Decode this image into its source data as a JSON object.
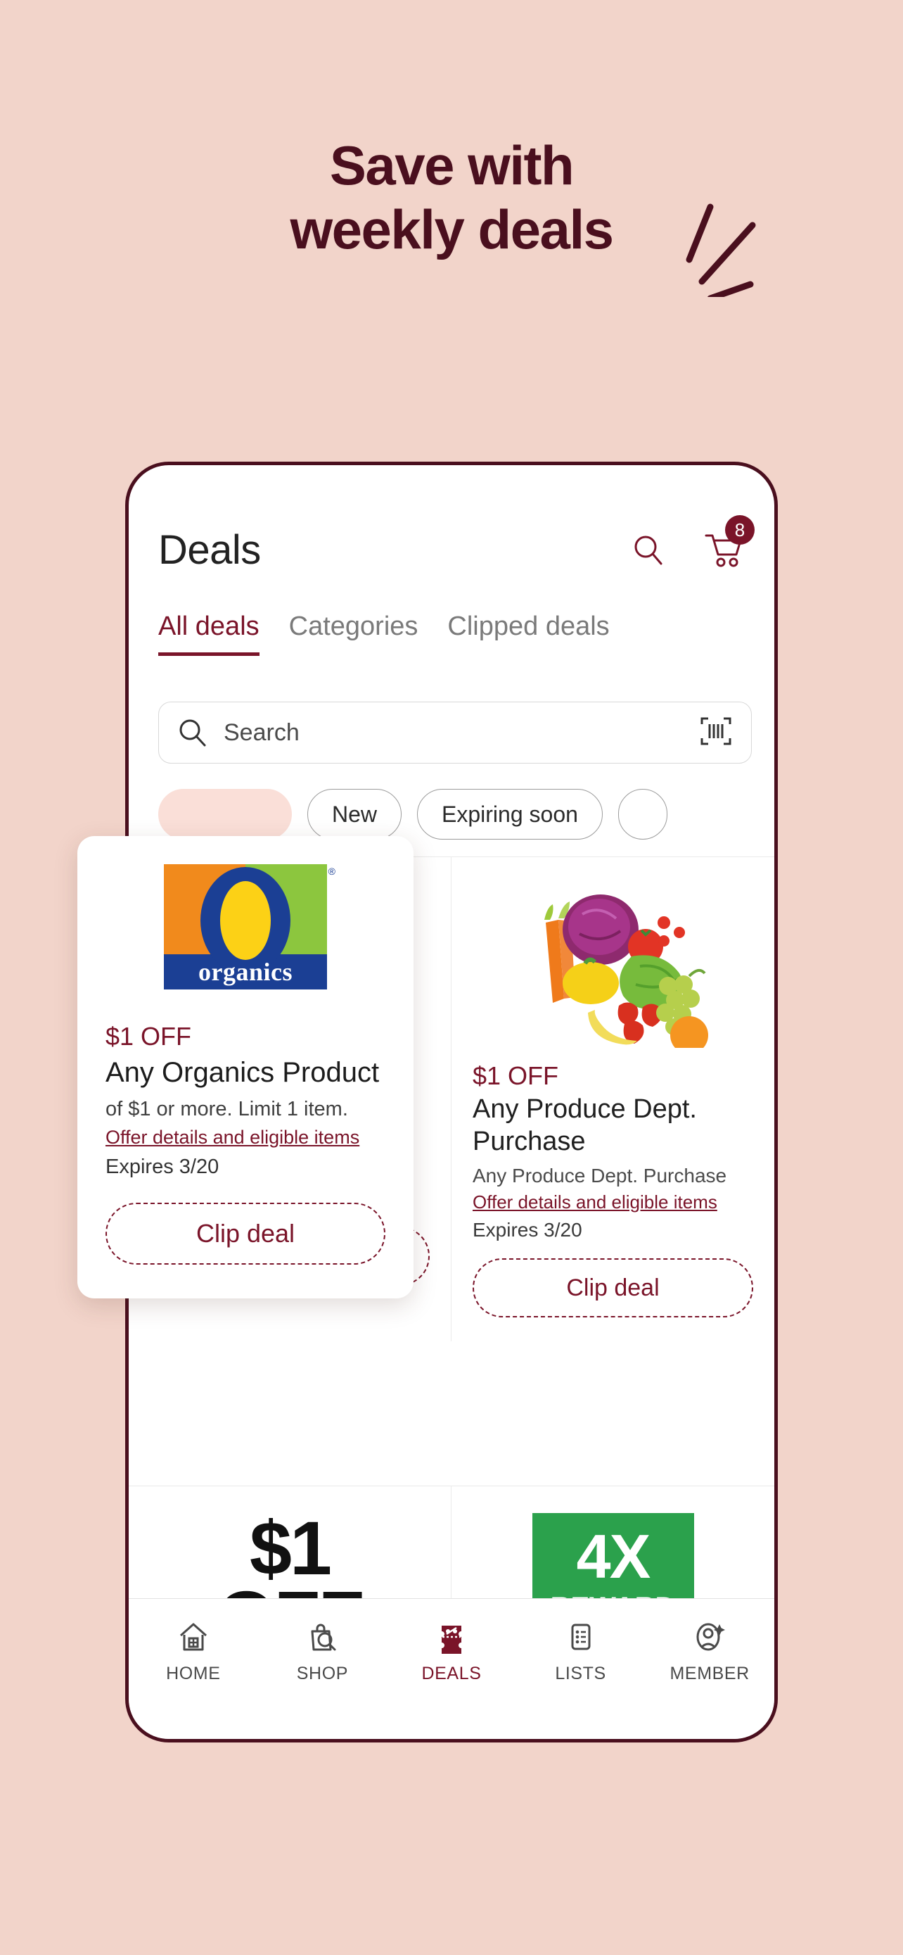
{
  "hero": {
    "line1": "Save with",
    "line2": "weekly deals",
    "sparkle_icon": "sparkle-lines-icon",
    "bg_color": "#f2d4ca",
    "text_color": "#4a0f1e"
  },
  "app": {
    "header": {
      "title": "Deals",
      "search_icon": "search-icon",
      "cart_icon": "cart-icon",
      "cart_badge": "8"
    },
    "tabs": [
      {
        "label": "All deals",
        "active": true
      },
      {
        "label": "Categories",
        "active": false
      },
      {
        "label": "Clipped deals",
        "active": false
      }
    ],
    "search": {
      "placeholder": "Search",
      "search_icon": "search-icon",
      "barcode_icon": "barcode-scan-icon"
    },
    "chips": [
      {
        "label": "",
        "selected": true
      },
      {
        "label": "New",
        "selected": false
      },
      {
        "label": "Expiring soon",
        "selected": false
      },
      {
        "label": "",
        "selected": false
      }
    ],
    "deals": [
      {
        "image": "o-organics-logo",
        "discount": "$1 OFF",
        "title": "Any Organics Product",
        "subtitle": "of $1 or more. Limit 1 item.",
        "link": "Offer details and eligible items",
        "expires": "Expires 3/20",
        "clip_label": "Clip deal"
      },
      {
        "image": "produce-assortment-photo",
        "discount": "$1 OFF",
        "title": "Any Produce Dept. Purchase",
        "subtitle": "Any Produce Dept. Purchase",
        "link": "Offer details and eligible items",
        "expires": "Expires 3/20",
        "clip_label": "Clip deal"
      }
    ],
    "bottom_partial": {
      "left_amount": "$1",
      "left_label": "OFF",
      "reward_multiplier": "4X",
      "reward_label": "REWARD",
      "reward_color": "#2ba14c"
    },
    "bottom_nav": [
      {
        "label": "HOME",
        "icon": "home-icon",
        "active": false
      },
      {
        "label": "SHOP",
        "icon": "shop-bag-icon",
        "active": false
      },
      {
        "label": "DEALS",
        "icon": "ticket-percent-icon",
        "active": true
      },
      {
        "label": "LISTS",
        "icon": "list-icon",
        "active": false
      },
      {
        "label": "MEMBER",
        "icon": "member-account-icon",
        "active": false
      }
    ],
    "accent_color": "#7a1429"
  },
  "float_card": {
    "image": "o-organics-logo",
    "logo_word": "organics",
    "discount": "$1 OFF",
    "title": "Any Organics Product",
    "subtitle": "of $1 or more. Limit 1 item.",
    "link": "Offer details and eligible items",
    "expires": "Expires 3/20",
    "clip_label": "Clip deal"
  }
}
